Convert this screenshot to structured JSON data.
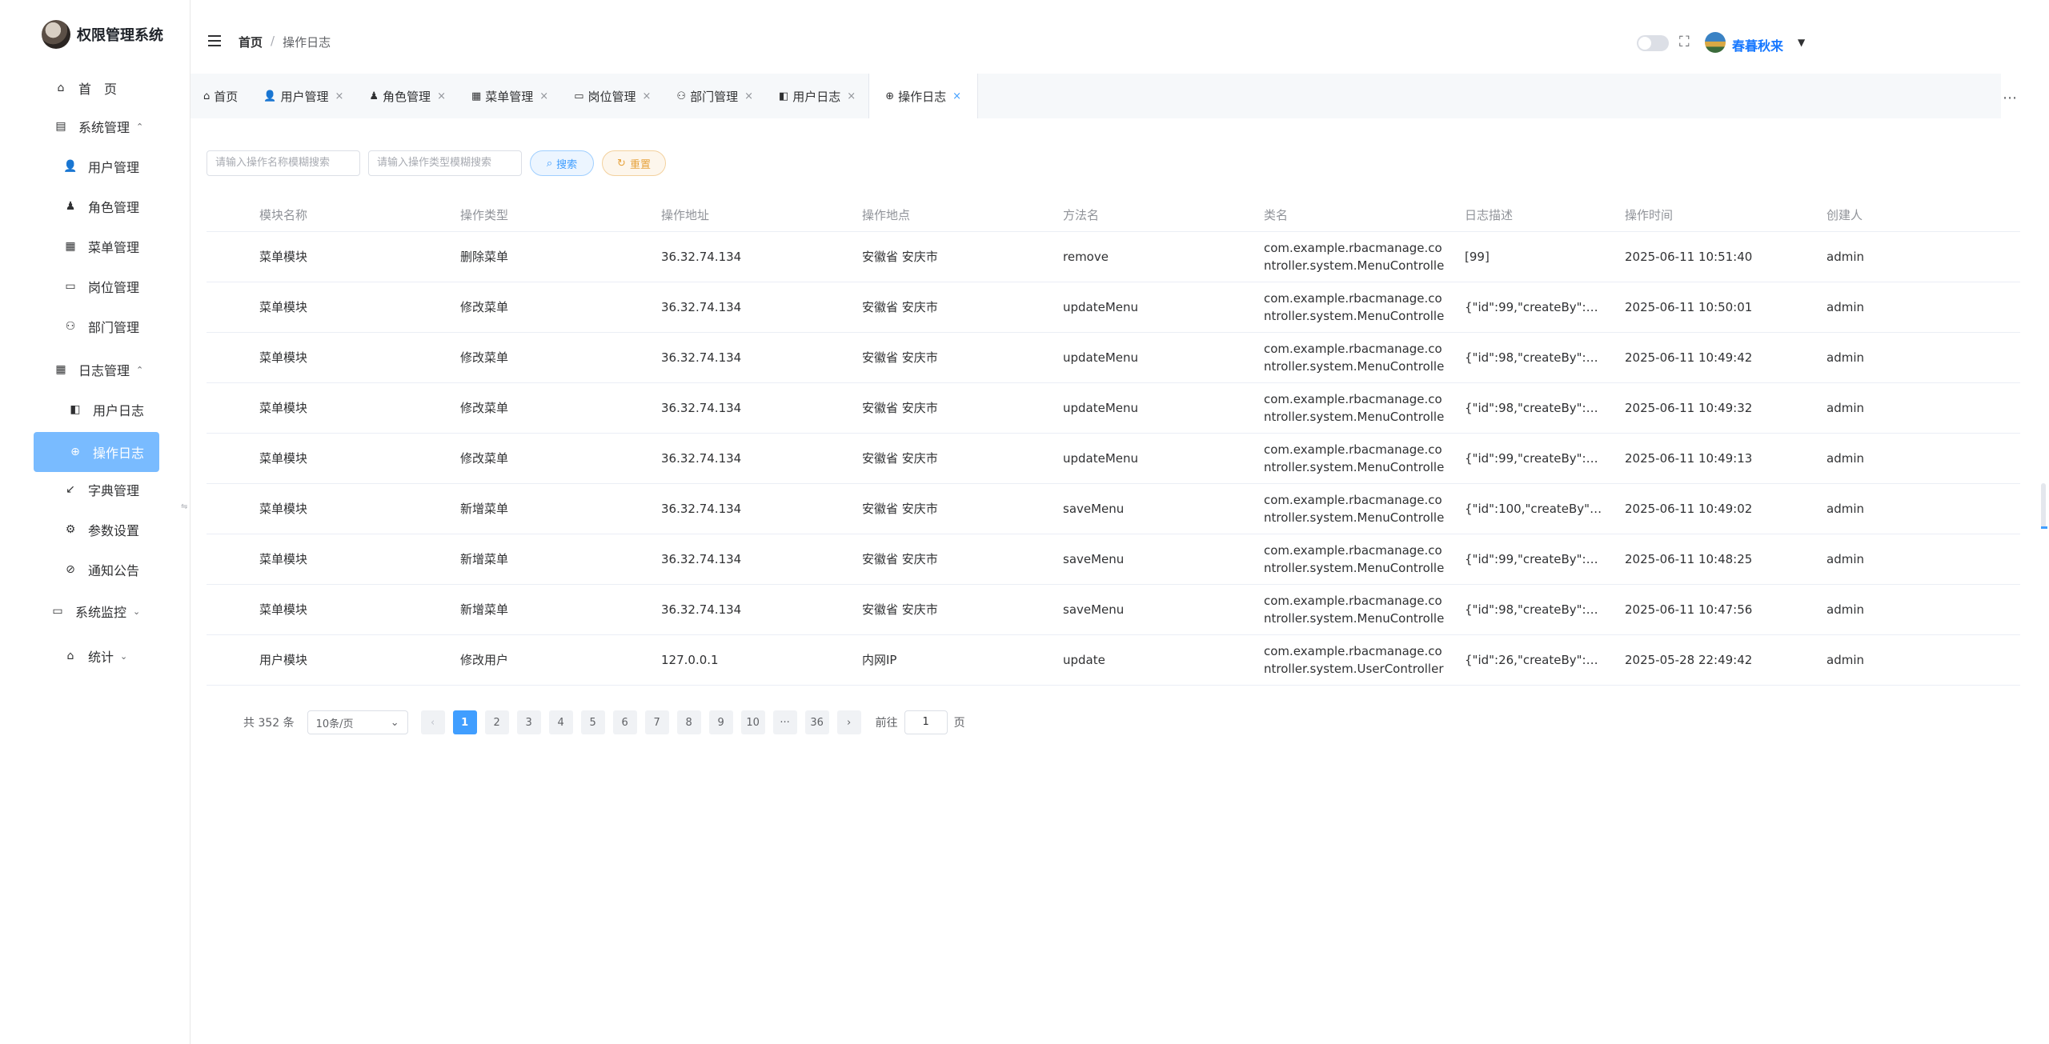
{
  "app": {
    "title": "权限管理系统"
  },
  "sidebar": {
    "items": [
      {
        "label": "首　页",
        "icon": "home-icon",
        "glyph": "⌂"
      },
      {
        "label": "系统管理",
        "icon": "system-icon",
        "glyph": "▤",
        "arrow": "⌃"
      },
      {
        "label": "用户管理",
        "icon": "user-icon",
        "glyph": "👤"
      },
      {
        "label": "角色管理",
        "icon": "role-icon",
        "glyph": "♟"
      },
      {
        "label": "菜单管理",
        "icon": "menu-grid-icon",
        "glyph": "▦"
      },
      {
        "label": "岗位管理",
        "icon": "post-icon",
        "glyph": "▭"
      },
      {
        "label": "部门管理",
        "icon": "dept-icon",
        "glyph": "⚇"
      },
      {
        "label": "日志管理",
        "icon": "log-icon",
        "glyph": "▦",
        "arrow": "⌃"
      },
      {
        "label": "用户日志",
        "icon": "user-log-icon",
        "glyph": "◧"
      },
      {
        "label": "操作日志",
        "icon": "operation-log-icon",
        "glyph": "⊕"
      },
      {
        "label": "字典管理",
        "icon": "dict-icon",
        "glyph": "↙"
      },
      {
        "label": "参数设置",
        "icon": "params-icon",
        "glyph": "⚙"
      },
      {
        "label": "通知公告",
        "icon": "notice-icon",
        "glyph": "⊘"
      },
      {
        "label": "系统监控",
        "icon": "monitor-icon",
        "glyph": "▭",
        "arrow": "⌄"
      },
      {
        "label": "统计",
        "icon": "stats-icon",
        "glyph": "⌂",
        "arrow": "⌄"
      }
    ]
  },
  "header": {
    "breadcrumb": {
      "home": "首页",
      "sep": "/",
      "current": "操作日志"
    },
    "username": "春暮秋来",
    "fullscreen_glyph": "⛶",
    "caret": "▼"
  },
  "tabs": [
    {
      "label": "首页",
      "glyph": "⌂",
      "closable": false
    },
    {
      "label": "用户管理",
      "glyph": "👤",
      "closable": true
    },
    {
      "label": "角色管理",
      "glyph": "♟",
      "closable": true
    },
    {
      "label": "菜单管理",
      "glyph": "▦",
      "closable": true
    },
    {
      "label": "岗位管理",
      "glyph": "▭",
      "closable": true
    },
    {
      "label": "部门管理",
      "glyph": "⚇",
      "closable": true
    },
    {
      "label": "用户日志",
      "glyph": "◧",
      "closable": true
    },
    {
      "label": "操作日志",
      "glyph": "⊕",
      "closable": true,
      "active": true
    }
  ],
  "tab_close_glyph": "×",
  "tab_more": "⋯",
  "filters": {
    "op_name_placeholder": "请输入操作名称模糊搜索",
    "op_type_placeholder": "请输入操作类型模糊搜索",
    "search_label": "搜索",
    "reset_label": "重置",
    "search_glyph": "⌕",
    "reset_glyph": "↻"
  },
  "table": {
    "columns": [
      "模块名称",
      "操作类型",
      "操作地址",
      "操作地点",
      "方法名",
      "类名",
      "日志描述",
      "操作时间",
      "创建人"
    ],
    "rows": [
      [
        "菜单模块",
        "删除菜单",
        "36.32.74.134",
        "安徽省 安庆市",
        "remove",
        "com.example.rbacmanage.controller.system.MenuController",
        "[99]",
        "2025-06-11 10:51:40",
        "admin"
      ],
      [
        "菜单模块",
        "修改菜单",
        "36.32.74.134",
        "安徽省 安庆市",
        "updateMenu",
        "com.example.rbacmanage.controller.system.MenuController",
        "{\"id\":99,\"createBy\":null,...",
        "2025-06-11 10:50:01",
        "admin"
      ],
      [
        "菜单模块",
        "修改菜单",
        "36.32.74.134",
        "安徽省 安庆市",
        "updateMenu",
        "com.example.rbacmanage.controller.system.MenuController",
        "{\"id\":98,\"createBy\":null,...",
        "2025-06-11 10:49:42",
        "admin"
      ],
      [
        "菜单模块",
        "修改菜单",
        "36.32.74.134",
        "安徽省 安庆市",
        "updateMenu",
        "com.example.rbacmanage.controller.system.MenuController",
        "{\"id\":98,\"createBy\":null,...",
        "2025-06-11 10:49:32",
        "admin"
      ],
      [
        "菜单模块",
        "修改菜单",
        "36.32.74.134",
        "安徽省 安庆市",
        "updateMenu",
        "com.example.rbacmanage.controller.system.MenuController",
        "{\"id\":99,\"createBy\":null,...",
        "2025-06-11 10:49:13",
        "admin"
      ],
      [
        "菜单模块",
        "新增菜单",
        "36.32.74.134",
        "安徽省 安庆市",
        "saveMenu",
        "com.example.rbacmanage.controller.system.MenuController",
        "{\"id\":100,\"createBy\":nul...",
        "2025-06-11 10:49:02",
        "admin"
      ],
      [
        "菜单模块",
        "新增菜单",
        "36.32.74.134",
        "安徽省 安庆市",
        "saveMenu",
        "com.example.rbacmanage.controller.system.MenuController",
        "{\"id\":99,\"createBy\":null,...",
        "2025-06-11 10:48:25",
        "admin"
      ],
      [
        "菜单模块",
        "新增菜单",
        "36.32.74.134",
        "安徽省 安庆市",
        "saveMenu",
        "com.example.rbacmanage.controller.system.MenuController",
        "{\"id\":98,\"createBy\":null,...",
        "2025-06-11 10:47:56",
        "admin"
      ],
      [
        "用户模块",
        "修改用户",
        "127.0.0.1",
        "内网IP",
        "update",
        "com.example.rbacmanage.controller.system.UserController",
        "{\"id\":26,\"createBy\":null,...",
        "2025-05-28 22:49:42",
        "admin"
      ]
    ]
  },
  "pagination": {
    "total": "共 352 条",
    "page_size": "10条/页",
    "select_glyph": "⌄",
    "prev": "‹",
    "next": "›",
    "pages": [
      "1",
      "2",
      "3",
      "4",
      "5",
      "6",
      "7",
      "8",
      "9",
      "10",
      "···",
      "36"
    ],
    "current": "1",
    "goto_label": "前往",
    "goto_value": "1",
    "goto_suffix": "页"
  },
  "colors": {
    "accent": "#409eff",
    "active_menu_bg": "#79bbff",
    "warning": "#e6a23c"
  }
}
